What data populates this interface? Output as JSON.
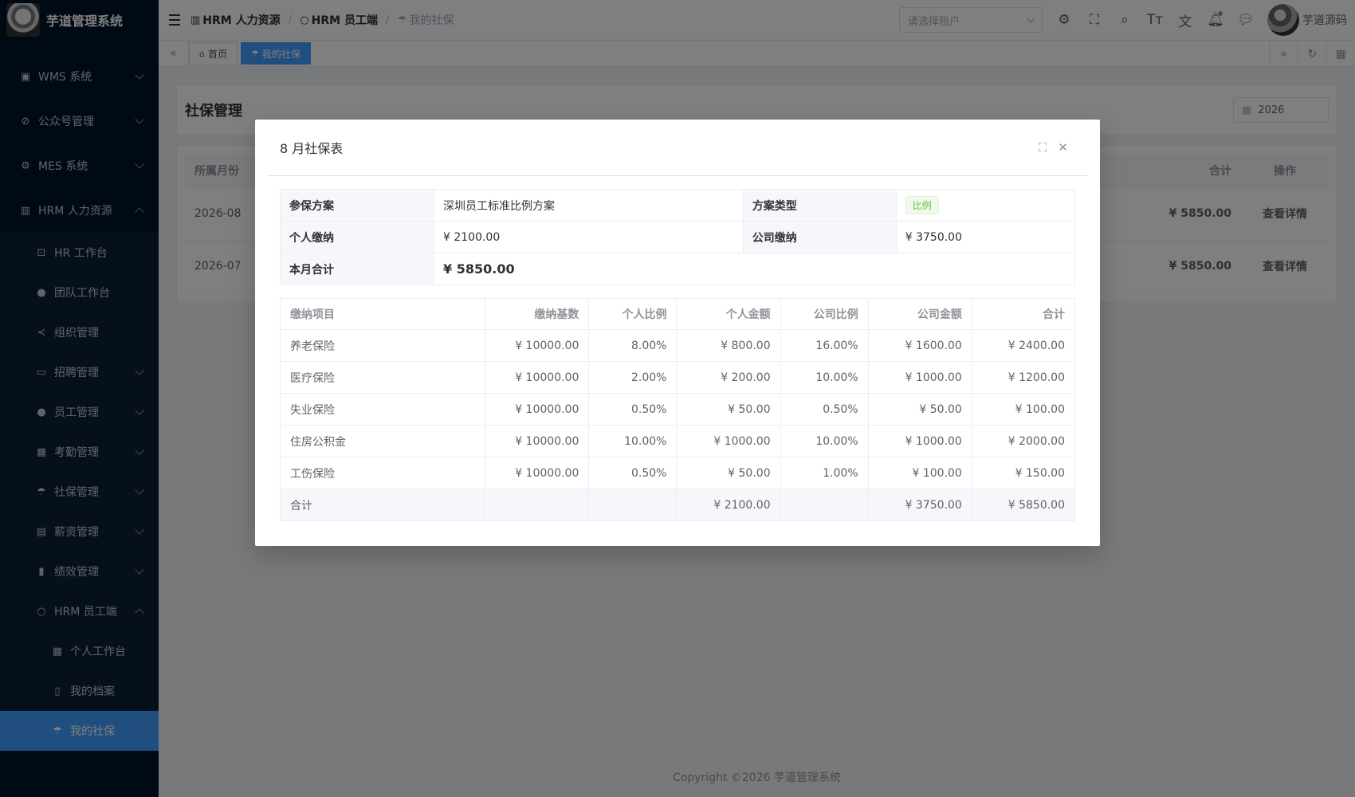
{
  "app": {
    "title": "芋道管理系统"
  },
  "sidebar": {
    "items": [
      {
        "label": "WMS 系统",
        "icon": "box-icon"
      },
      {
        "label": "公众号管理",
        "icon": "compass-icon"
      },
      {
        "label": "MES 系统",
        "icon": "gear-icon"
      },
      {
        "label": "HRM 人力资源",
        "icon": "building-icon"
      }
    ],
    "hrm_children": [
      {
        "label": "HR 工作台"
      },
      {
        "label": "团队工作台"
      },
      {
        "label": "组织管理"
      },
      {
        "label": "招聘管理"
      },
      {
        "label": "员工管理"
      },
      {
        "label": "考勤管理"
      },
      {
        "label": "社保管理"
      },
      {
        "label": "薪资管理"
      },
      {
        "label": "绩效管理"
      },
      {
        "label": "HRM 员工端"
      }
    ],
    "employee_children": [
      {
        "label": "个人工作台"
      },
      {
        "label": "我的档案"
      },
      {
        "label": "我的社保"
      }
    ]
  },
  "navbar": {
    "breadcrumb": [
      "HRM 人力资源",
      "HRM 员工端",
      "我的社保"
    ],
    "tenant_placeholder": "请选择租户",
    "user_name": "芋道源码"
  },
  "tags": {
    "home": "首页",
    "current": "我的社保"
  },
  "page": {
    "title": "社保管理",
    "year": "2026",
    "table": {
      "headers": {
        "month": "所属月份",
        "total": "合计",
        "action": "操作"
      },
      "rows": [
        {
          "month": "2026-08",
          "total": "¥ 5850.00",
          "action": "查看详情"
        },
        {
          "month": "2026-07",
          "total": "¥ 5850.00",
          "action": "查看详情"
        }
      ]
    }
  },
  "footer": {
    "copyright": "Copyright ©2026 芋道管理系统"
  },
  "dialog": {
    "title": "8 月社保表",
    "summary": {
      "plan_label": "参保方案",
      "plan_value": "深圳员工标准比例方案",
      "type_label": "方案类型",
      "type_value": "比例",
      "personal_label": "个人缴纳",
      "personal_value": "¥ 2100.00",
      "company_label": "公司缴纳",
      "company_value": "¥ 3750.00",
      "total_label": "本月合计",
      "total_value": "¥ 5850.00"
    },
    "detail": {
      "headers": [
        "缴纳项目",
        "缴纳基数",
        "个人比例",
        "个人金额",
        "公司比例",
        "公司金额",
        "合计"
      ],
      "rows": [
        [
          "养老保险",
          "¥ 10000.00",
          "8.00%",
          "¥ 800.00",
          "16.00%",
          "¥ 1600.00",
          "¥ 2400.00"
        ],
        [
          "医疗保险",
          "¥ 10000.00",
          "2.00%",
          "¥ 200.00",
          "10.00%",
          "¥ 1000.00",
          "¥ 1200.00"
        ],
        [
          "失业保险",
          "¥ 10000.00",
          "0.50%",
          "¥ 50.00",
          "0.50%",
          "¥ 50.00",
          "¥ 100.00"
        ],
        [
          "住房公积金",
          "¥ 10000.00",
          "10.00%",
          "¥ 1000.00",
          "10.00%",
          "¥ 1000.00",
          "¥ 2000.00"
        ],
        [
          "工伤保险",
          "¥ 10000.00",
          "0.50%",
          "¥ 50.00",
          "1.00%",
          "¥ 100.00",
          "¥ 150.00"
        ]
      ],
      "sum": [
        "合计",
        "",
        "",
        "¥ 2100.00",
        "",
        "¥ 3750.00",
        "¥ 5850.00"
      ]
    }
  }
}
